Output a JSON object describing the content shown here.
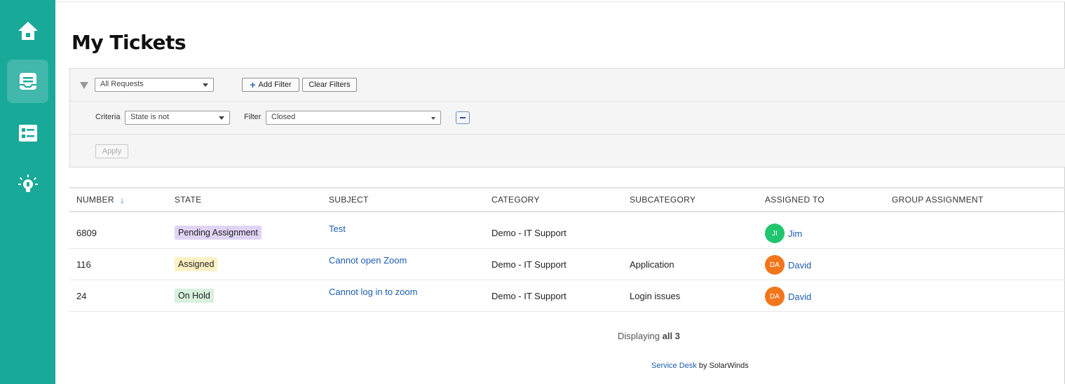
{
  "sidebar": {
    "items": [
      {
        "name": "home",
        "icon": "home-icon"
      },
      {
        "name": "tickets",
        "icon": "ticket-inbox-icon",
        "active": true
      },
      {
        "name": "catalog",
        "icon": "list-icon"
      },
      {
        "name": "ideas",
        "icon": "lightbulb-icon"
      }
    ]
  },
  "page": {
    "title": "My Tickets"
  },
  "filters": {
    "view_select": "All Requests",
    "add_filter_label": "Add Filter",
    "clear_filters_label": "Clear Filters",
    "criteria_label": "Criteria",
    "criteria_value": "State is not",
    "filter_label": "Filter",
    "filter_value": "Closed",
    "apply_label": "Apply"
  },
  "table": {
    "columns": [
      "NUMBER",
      "STATE",
      "SUBJECT",
      "CATEGORY",
      "SUBCATEGORY",
      "ASSIGNED TO",
      "GROUP ASSIGNMENT"
    ],
    "rows": [
      {
        "number": "6809",
        "state": "Pending Assignment",
        "state_color": "#e0d4f5",
        "subject": "Test",
        "category": "Demo - IT Support",
        "subcategory": "",
        "avatar": "JI",
        "avatar_color": "#1fc66f",
        "assignee": "Jim",
        "group": ""
      },
      {
        "number": "116",
        "state": "Assigned",
        "state_color": "#fff1c4",
        "subject": "Cannot open Zoom",
        "category": "Demo - IT Support",
        "subcategory": "Application",
        "avatar": "DA",
        "avatar_color": "#f3761c",
        "assignee": "David",
        "group": ""
      },
      {
        "number": "24",
        "state": "On Hold",
        "state_color": "#d7f1dc",
        "subject": "Cannot log in to zoom",
        "category": "Demo - IT Support",
        "subcategory": "Login issues",
        "avatar": "DA",
        "avatar_color": "#f3761c",
        "assignee": "David",
        "group": ""
      }
    ]
  },
  "summary": {
    "prefix": "Displaying",
    "count": "all 3"
  },
  "footer": {
    "link": "Service Desk",
    "suffix": "by SolarWinds"
  },
  "colors": {
    "sidebar": "#18a999",
    "link": "#1e5db0"
  }
}
